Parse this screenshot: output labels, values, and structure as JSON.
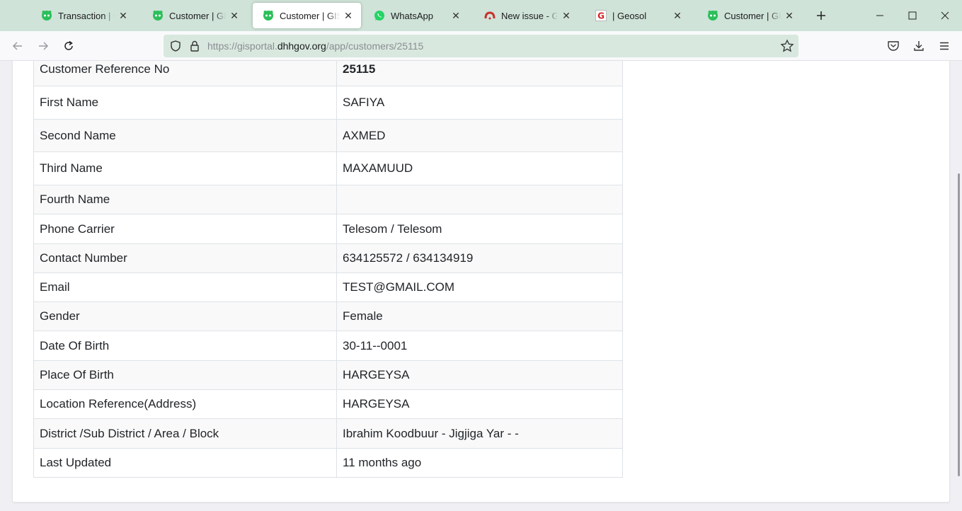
{
  "browser": {
    "tabs": [
      {
        "title": "Transaction | GIS Portal",
        "favicon": "green-face-icon",
        "active": false
      },
      {
        "title": "Customer | GIS Portal",
        "favicon": "green-face-icon",
        "active": false
      },
      {
        "title": "Customer | GIS Portal",
        "favicon": "green-face-icon",
        "active": true
      },
      {
        "title": "WhatsApp",
        "favicon": "whatsapp-icon",
        "active": false
      },
      {
        "title": "New issue - GIS-Hargeisa",
        "favicon": "gitlab-icon",
        "active": false
      },
      {
        "title": "| Geosol",
        "favicon": "geosol-icon",
        "active": false
      },
      {
        "title": "Customer | GIS Portal",
        "favicon": "green-face-icon",
        "active": false
      }
    ],
    "url": {
      "prefix": "https://gisportal.",
      "domain": "dhhgov.org",
      "path": "/app/customers/25115"
    }
  },
  "customer": {
    "rows": [
      {
        "label": "Customer Reference No",
        "value": "25115"
      },
      {
        "label": "First Name",
        "value": "SAFIYA"
      },
      {
        "label": "Second Name",
        "value": "AXMED"
      },
      {
        "label": "Third Name",
        "value": "MAXAMUUD"
      },
      {
        "label": "Fourth Name",
        "value": ""
      },
      {
        "label": "Phone Carrier",
        "value": "Telesom / Telesom"
      },
      {
        "label": "Contact Number",
        "value": "634125572 / 634134919"
      },
      {
        "label": "Email",
        "value": "TEST@GMAIL.COM"
      },
      {
        "label": "Gender",
        "value": "Female"
      },
      {
        "label": "Date Of Birth",
        "value": "30-11--0001"
      },
      {
        "label": "Place Of Birth",
        "value": "HARGEYSA"
      },
      {
        "label": "Location Reference(Address)",
        "value": "HARGEYSA"
      },
      {
        "label": "District /Sub District / Area / Block",
        "value": "Ibrahim Koodbuur - Jigjiga Yar - -"
      },
      {
        "label": "Last Updated",
        "value": "11 months ago"
      }
    ]
  },
  "colors": {
    "tabstrip": "#cfe3d8",
    "urlbar": "#d8e8de",
    "favicon_green": "#2bbf5a"
  }
}
